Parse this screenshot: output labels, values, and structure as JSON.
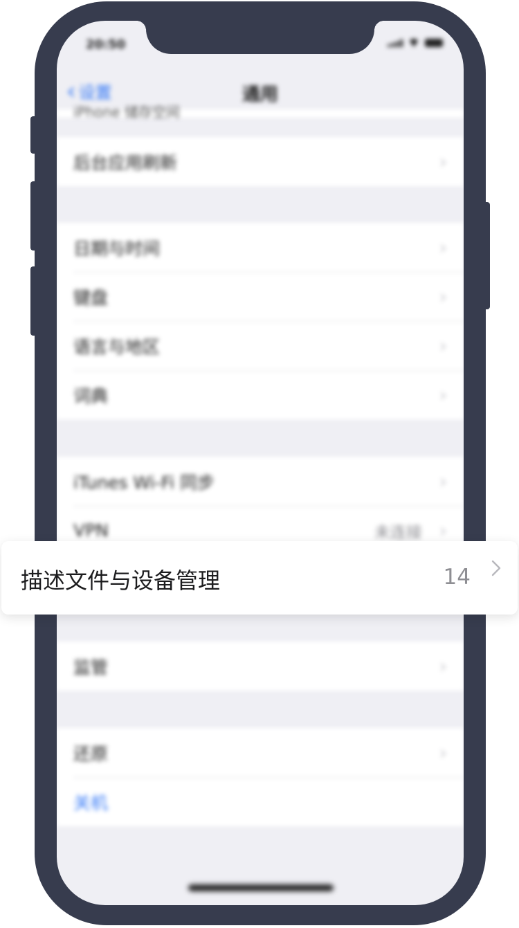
{
  "status": {
    "time": "20:50"
  },
  "nav": {
    "back_label": "设置",
    "title": "通用"
  },
  "peek_row_label": "iPhone 储存空间",
  "groups": [
    {
      "items": [
        {
          "label": "后台应用刷新"
        }
      ]
    },
    {
      "items": [
        {
          "label": "日期与时间"
        },
        {
          "label": "键盘"
        },
        {
          "label": "语言与地区"
        },
        {
          "label": "词典"
        }
      ]
    },
    {
      "items": [
        {
          "label": "iTunes Wi-Fi 同步"
        },
        {
          "label": "VPN",
          "value": "未连接"
        }
      ]
    },
    {
      "items": [
        {
          "label": "监管"
        }
      ]
    },
    {
      "items": [
        {
          "label": "还原"
        },
        {
          "label": "关机"
        }
      ]
    }
  ],
  "highlight": {
    "label": "描述文件与设备管理",
    "count": "14"
  },
  "colors": {
    "frame": "#373c4e",
    "accent": "#3478f6"
  }
}
